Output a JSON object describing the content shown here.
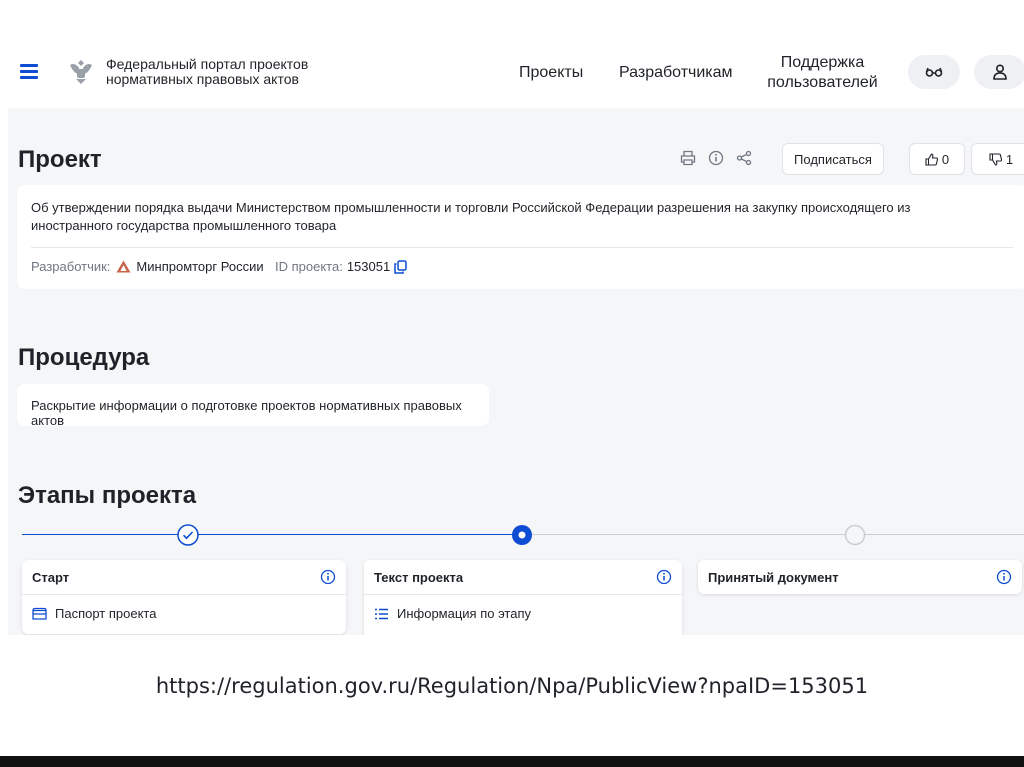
{
  "header": {
    "portal_title": "Федеральный портал проектов нормативных правовых актов",
    "nav": {
      "projects": "Проекты",
      "developers": "Разработчикам",
      "support": "Поддержка пользователей"
    }
  },
  "project": {
    "heading": "Проект",
    "subscribe_label": "Подписаться",
    "likes": "0",
    "dislikes": "1",
    "title": "Об утверждении порядка выдачи Министерством промышленности и торговли Российской Федерации разрешения на закупку происходящего из иностранного государства промышленного товара",
    "developer_label": "Разработчик:",
    "developer_name": "Минпромторг России",
    "id_label": "ID проекта:",
    "id_value": "153051"
  },
  "procedure": {
    "heading": "Процедура",
    "text": "Раскрытие информации о подготовке проектов нормативных правовых актов"
  },
  "stages": {
    "heading": "Этапы проекта",
    "items": [
      {
        "title": "Старт",
        "row": "Паспорт проекта",
        "status": "completed"
      },
      {
        "title": "Текст проекта",
        "row": "Информация по этапу",
        "status": "current"
      },
      {
        "title": "Принятый документ",
        "status": "pending"
      }
    ]
  },
  "caption_url": "https://regulation.gov.ru/Regulation/Npa/PublicView?npaID=153051",
  "colors": {
    "accent": "#0d4cd3",
    "background": "#f5f6f8",
    "text": "#1f2329",
    "muted": "#6f7782"
  }
}
